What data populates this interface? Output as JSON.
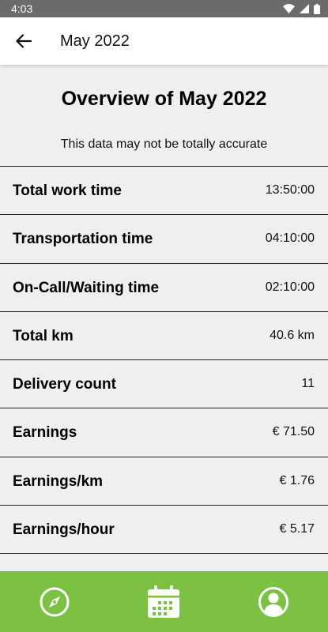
{
  "status_bar": {
    "time": "4:03"
  },
  "app_bar": {
    "title": "May 2022"
  },
  "overview": {
    "title": "Overview of May 2022",
    "disclaimer": "This data may not be totally accurate"
  },
  "stats": [
    {
      "label": "Total work time",
      "value": "13:50:00"
    },
    {
      "label": "Transportation time",
      "value": "04:10:00"
    },
    {
      "label": "On-Call/Waiting time",
      "value": "02:10:00"
    },
    {
      "label": "Total km",
      "value": "40.6 km"
    },
    {
      "label": "Delivery count",
      "value": "11"
    },
    {
      "label": "Earnings",
      "value": "€ 71.50"
    },
    {
      "label": "Earnings/km",
      "value": "€ 1.76"
    },
    {
      "label": "Earnings/hour",
      "value": "€ 5.17"
    }
  ],
  "bottom_nav": {
    "items": [
      {
        "icon": "compass-icon"
      },
      {
        "icon": "calendar-icon"
      },
      {
        "icon": "account-icon"
      }
    ],
    "color": "#7cc143"
  }
}
